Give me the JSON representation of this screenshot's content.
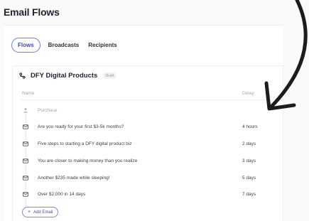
{
  "header": {
    "title": "Email Flows"
  },
  "tabs": [
    {
      "label": "Flows",
      "active": true
    },
    {
      "label": "Broadcasts",
      "active": false
    },
    {
      "label": "Recipients",
      "active": false
    }
  ],
  "flow": {
    "name": "DFY Digital Products",
    "status": "Draft",
    "columns": {
      "name": "Name",
      "delay": "Delay"
    },
    "trigger": {
      "label": "Purchase",
      "icon": "user-icon"
    },
    "emails": [
      {
        "subject": "Are you ready for your first $3-5k months?",
        "delay": "4 hours",
        "icon": "mail-icon"
      },
      {
        "subject": "Five steps to starting a DFY digital product biz",
        "delay": "2 days",
        "icon": "mail-icon"
      },
      {
        "subject": "You are closer to making money than you realize",
        "delay": "3 days",
        "icon": "mail-icon"
      },
      {
        "subject": "Another $235 made while sleeping!",
        "delay": "5 days",
        "icon": "mail-icon"
      },
      {
        "subject": "Over $2,000 in 14 days",
        "delay": "7 days",
        "icon": "mail-icon"
      }
    ],
    "add_email_label": "Add Email"
  },
  "colors": {
    "accent": "#3b4ab6",
    "accent_border": "#6e7ed6",
    "title": "#1e2233",
    "muted": "#a2a7b4",
    "arrow": "#1c1c1c"
  }
}
